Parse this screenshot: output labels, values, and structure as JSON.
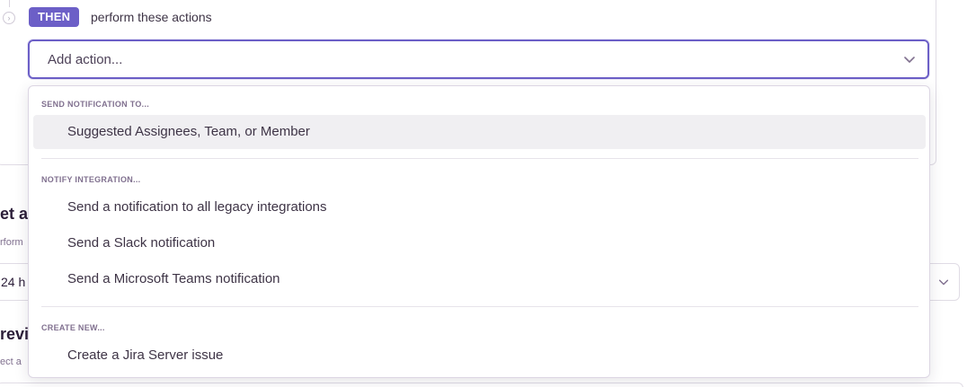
{
  "rule_step": {
    "badge": "THEN",
    "description": "perform these actions"
  },
  "action_select": {
    "placeholder": "Add action..."
  },
  "background": {
    "heading_1": "et a",
    "subtext_1": "rform",
    "field_value": "24 h",
    "heading_2": "revi",
    "subtext_2": "ect a"
  },
  "menu": {
    "groups": [
      {
        "header": "SEND NOTIFICATION TO...",
        "items": [
          "Suggested Assignees, Team, or Member"
        ]
      },
      {
        "header": "NOTIFY INTEGRATION...",
        "items": [
          "Send a notification to all legacy integrations",
          "Send a Slack notification",
          "Send a Microsoft Teams notification"
        ]
      },
      {
        "header": "CREATE NEW...",
        "items": [
          "Create a Jira Server issue"
        ]
      }
    ],
    "active_item": "Suggested Assignees, Team, or Member"
  },
  "colors": {
    "accent": "#6c5fc7",
    "text": "#2b1d38",
    "muted": "#80708f",
    "hover_bg": "#f0eff2"
  },
  "icons": {
    "select_caret": "chevron-down-icon",
    "step_marker": "circle-chevron-icon"
  }
}
